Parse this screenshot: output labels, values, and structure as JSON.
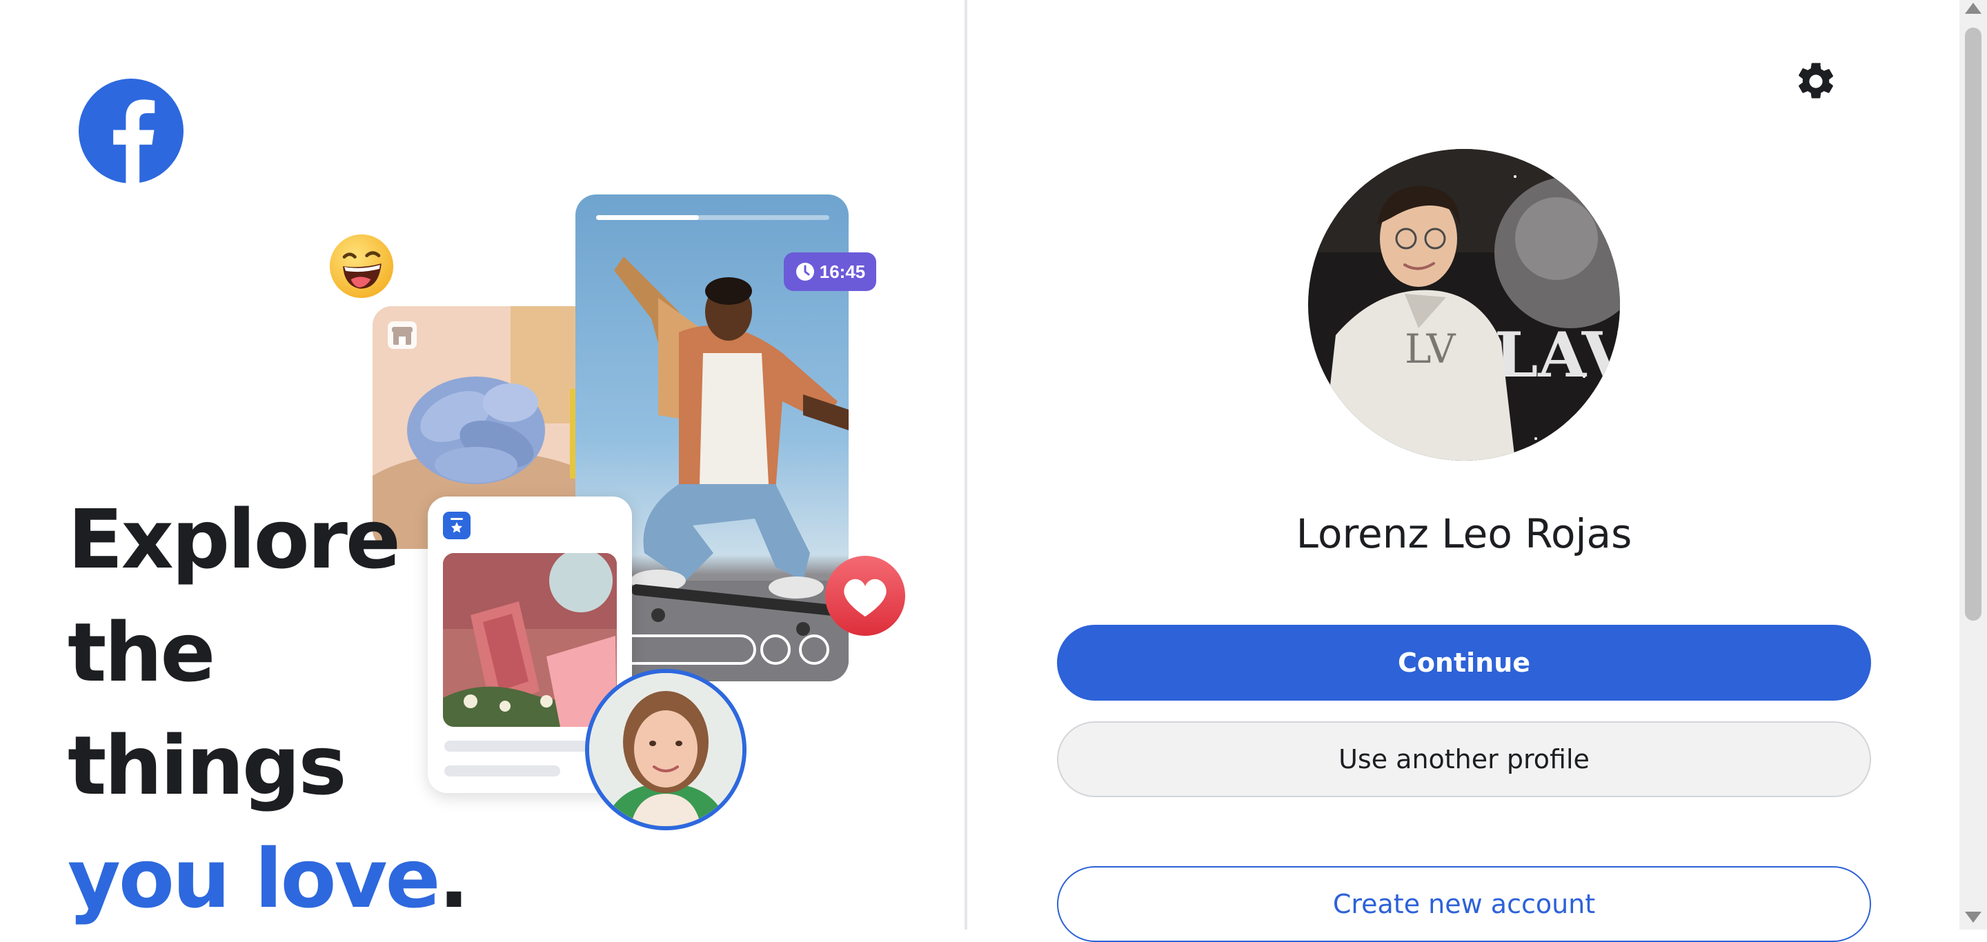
{
  "brand": {
    "logo_icon": "facebook-logo-icon",
    "color": "#2d68de"
  },
  "hero": {
    "headline_line1": "Explore",
    "headline_line2": "the",
    "headline_line3": "things",
    "headline_accent": "you love",
    "headline_period": ".",
    "accent_color": "#2d68de"
  },
  "collage": {
    "timer_label": "16:45",
    "video_progress": 0.44,
    "icons": [
      "laughing-emoji-icon",
      "marketplace-icon",
      "clock-icon",
      "heart-icon",
      "event-icon"
    ]
  },
  "profile": {
    "name": "Lorenz Leo Rojas",
    "settings_icon": "gear-icon"
  },
  "actions": {
    "continue_label": "Continue",
    "another_profile_label": "Use another profile",
    "create_account_label": "Create new account"
  },
  "colors": {
    "primary_button": "#2d62d8",
    "secondary_button": "#f2f2f2",
    "timer_badge": "#6b5bd9",
    "heart_bubble": "#e8454f"
  }
}
